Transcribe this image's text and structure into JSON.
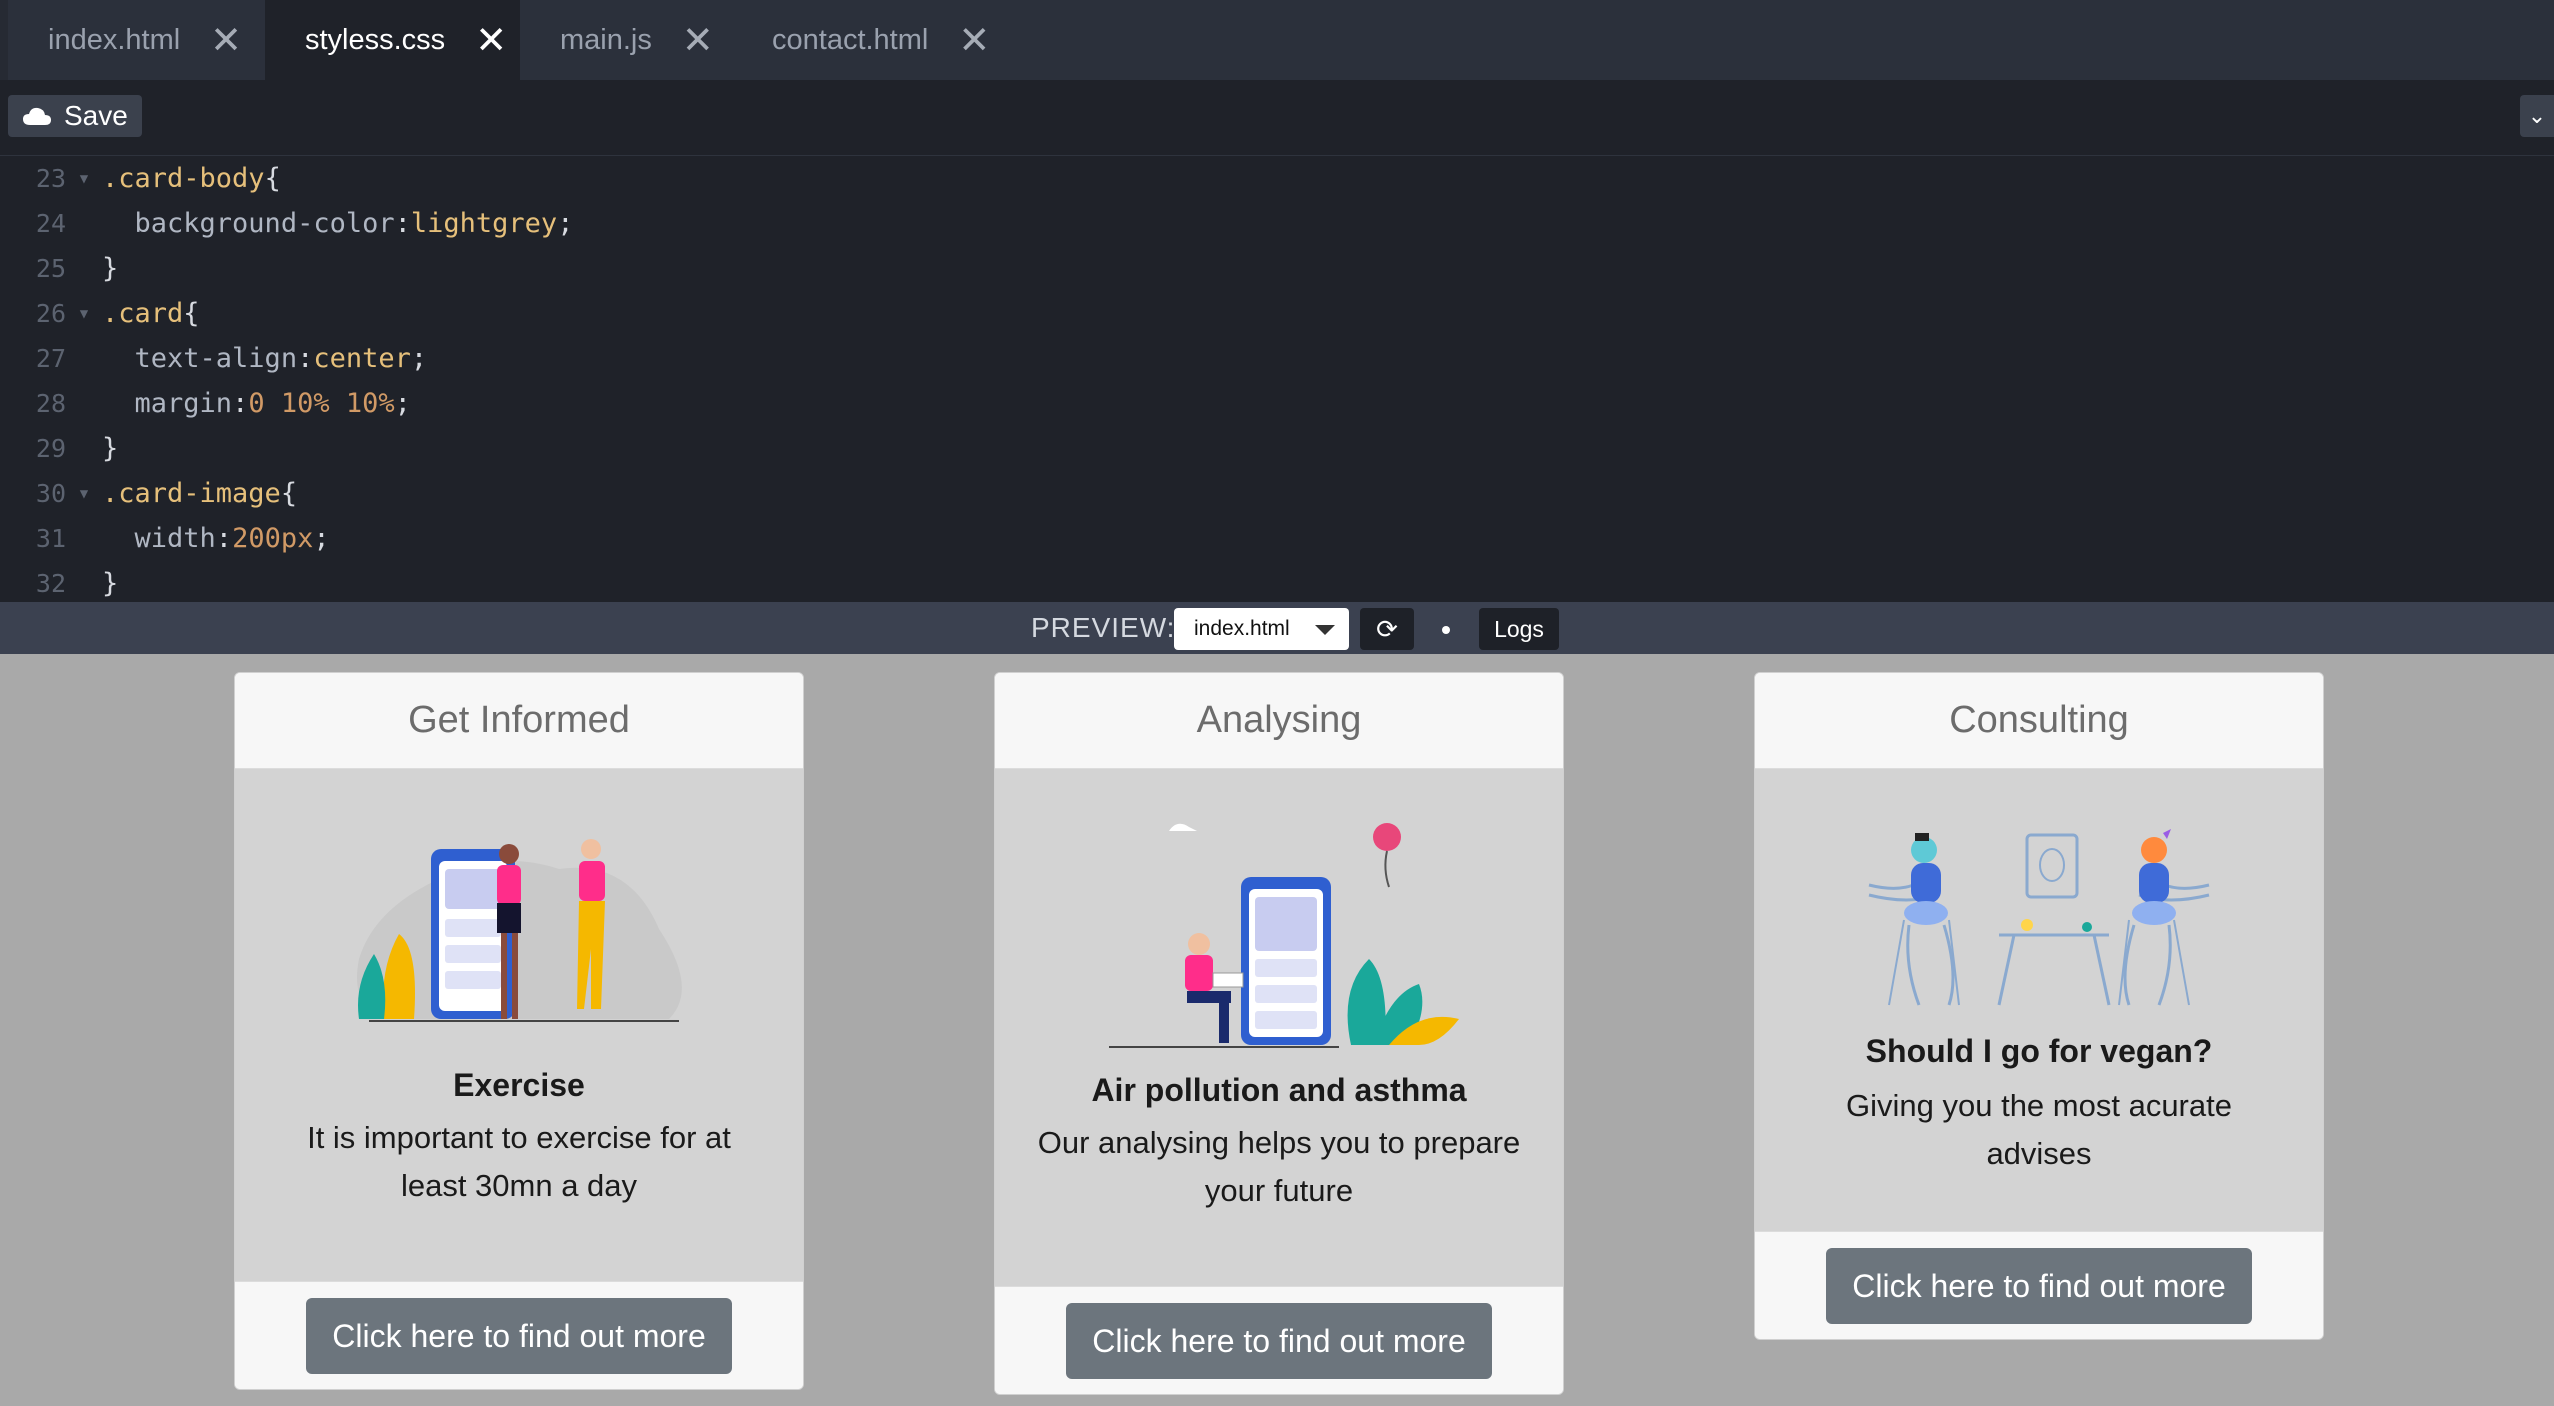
{
  "tabs": [
    {
      "label": "index.html",
      "active": false
    },
    {
      "label": "styless.css",
      "active": true
    },
    {
      "label": "main.js",
      "active": false
    },
    {
      "label": "contact.html",
      "active": false
    }
  ],
  "toolbar": {
    "save_label": "Save"
  },
  "editor": {
    "lines": [
      {
        "num": "23",
        "fold": true
      },
      {
        "num": "24",
        "fold": false
      },
      {
        "num": "25",
        "fold": false
      },
      {
        "num": "26",
        "fold": true
      },
      {
        "num": "27",
        "fold": false
      },
      {
        "num": "28",
        "fold": false
      },
      {
        "num": "29",
        "fold": false
      },
      {
        "num": "30",
        "fold": true
      },
      {
        "num": "31",
        "fold": false
      },
      {
        "num": "32",
        "fold": false
      }
    ],
    "code": {
      "l23_sel": ".card-body",
      "l23_brace": "{",
      "l24_prop": "background-color",
      "l24_colon": ":",
      "l24_val": "lightgrey",
      "l24_semi": ";",
      "l25": "}",
      "l26_sel": ".card",
      "l26_brace": "{",
      "l27_prop": "text-align",
      "l27_colon": ":",
      "l27_val": "center",
      "l27_semi": ";",
      "l28_prop": "margin",
      "l28_colon": ":",
      "l28_val": "0 10% 10%",
      "l28_semi": ";",
      "l29": "}",
      "l30_sel": ".card-image",
      "l30_brace": "{",
      "l31_prop": "width",
      "l31_colon": ":",
      "l31_val": "200px",
      "l31_semi": ";",
      "l32": "}"
    }
  },
  "preview_bar": {
    "label": "PREVIEW:",
    "selected_file": "index.html",
    "logs_label": "Logs"
  },
  "cards": [
    {
      "header": "Get Informed",
      "title": "Exercise",
      "text": "It is important to exercise for at least 30mn a day",
      "button": "Click here to find out more"
    },
    {
      "header": "Analysing",
      "title": "Air pollution and asthma",
      "text": "Our analysing helps you to prepare your future",
      "button": "Click here to find out more"
    },
    {
      "header": "Consulting",
      "title": "Should I go for vegan?",
      "text": "Giving you the most acurate advises",
      "button": "Click here to find out more"
    }
  ],
  "colors": {
    "editor_bg": "#1f2229",
    "tabbar_bg": "#2b303b",
    "preview_bg": "#a9a9a9",
    "card_body_bg": "#d3d3d3",
    "button_bg": "#6c757d"
  }
}
